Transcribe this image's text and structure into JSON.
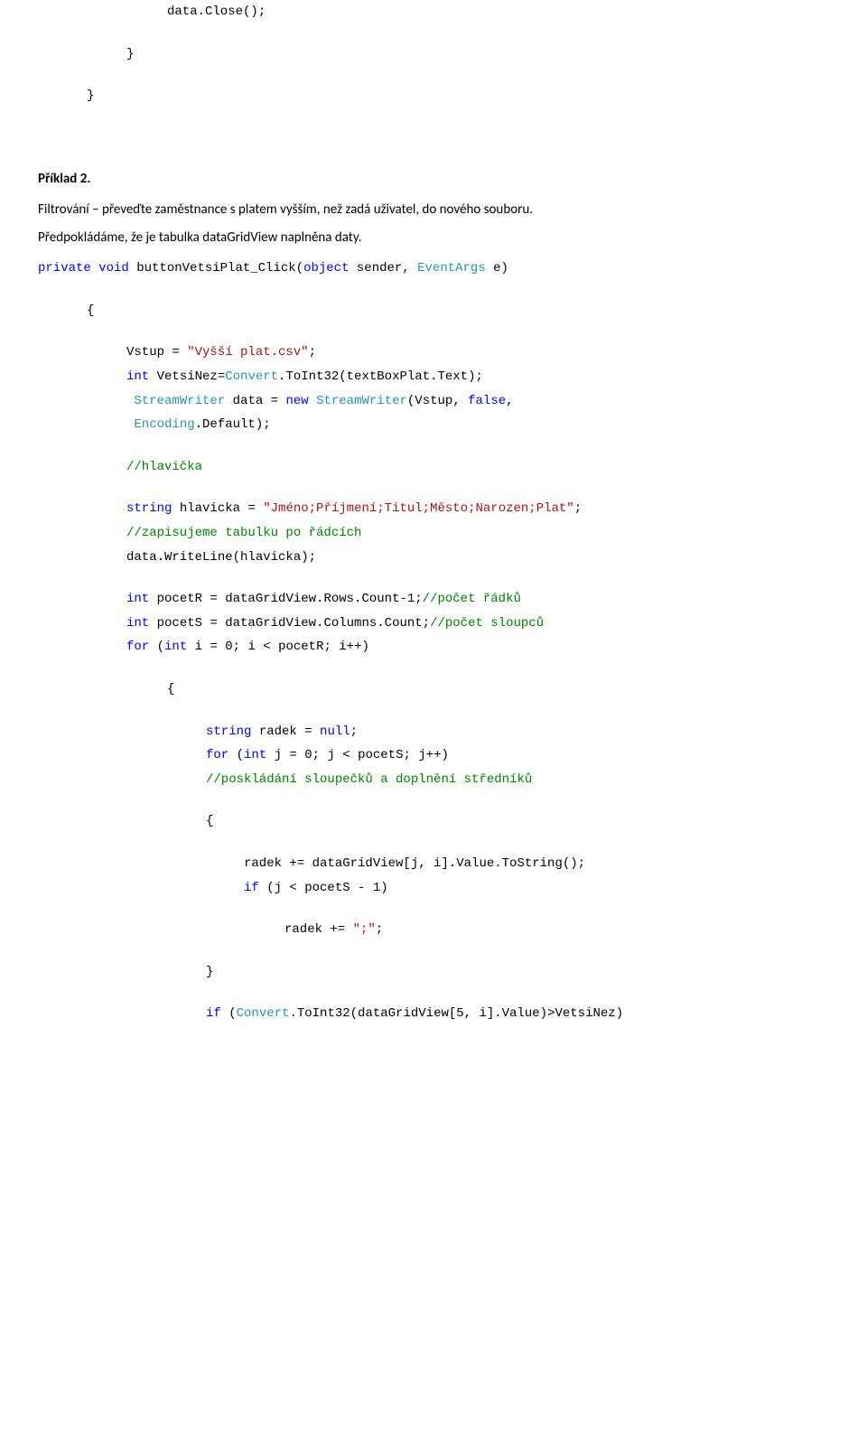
{
  "topCode": {
    "l1": "data.Close();",
    "l2": "}",
    "l3": "}"
  },
  "heading": "Příklad 2.",
  "para1": "Filtrování – převeďte zaměstnance s platem vyšším, než zadá uživatel, do nového souboru.",
  "para2": "Předpokládáme, že je tabulka dataGridView  naplněna daty.",
  "code": {
    "sig_private": "private",
    "sig_void": "void",
    "sig_name": " buttonVetsiPlat_Click(",
    "sig_object": "object",
    "sig_sender": " sender, ",
    "sig_eventargs": "EventArgs",
    "sig_e": " e)",
    "brace_open": "{",
    "vstup_lhs": "Vstup = ",
    "vstup_str": "\"Vyšší plat.csv\"",
    "vstup_semi": ";",
    "int_kw": "int",
    "vetsinez": " VetsiNez=",
    "convert": "Convert",
    "toint32": ".ToInt32(textBoxPlat.Text);",
    "streamwriter": "StreamWriter",
    "data_eq": " data = ",
    "new_kw": "new",
    "sw_ctor": "StreamWriter",
    "sw_args": "(Vstup, ",
    "false_kw": "false",
    "sw_comma": ",",
    "encoding": "Encoding",
    "default": ".Default);",
    "c_hlavicka": "//hlavička",
    "string_kw": "string",
    "hlavicka_eq": " hlavicka = ",
    "hlavicka_str": "\"Jméno;Příjmení;Titul;Město;Narozen;Plat\"",
    "hlavicka_semi": ";",
    "c_zapis": "//zapisujeme tabulku po řádcích",
    "writeline": "data.WriteLine(hlavicka);",
    "pocetR": " pocetR = dataGridView.Rows.Count-1;",
    "c_radku": "//počet řádků",
    "pocetS": " pocetS = dataGridView.Columns.Count;",
    "c_sloupcu": "//počet sloupců",
    "for_kw": "for",
    "for_open": " (",
    "for_i": " i = 0; i < pocetR; i++)",
    "brace_open2": "{",
    "radek_eq": " radek = ",
    "null_kw": "null",
    "radek_semi": ";",
    "for_j": " j = 0; j < pocetS; j++)",
    "c_posklad": "//poskládání sloupečků a doplnění středníků",
    "brace_open3": "{",
    "radek_append": "radek += dataGridView[j, i].Value.ToString();",
    "if_kw": "if",
    "if_cond": " (j < pocetS - 1)",
    "radek_semi_append": "radek += ",
    "semi_str": "\";\"",
    "semi_semi": ";",
    "brace_close": "}",
    "convert2": "Convert",
    "toint32_2": ".ToInt32(dataGridView[5, i].Value)>VetsiNez)",
    "if_open": " ("
  }
}
